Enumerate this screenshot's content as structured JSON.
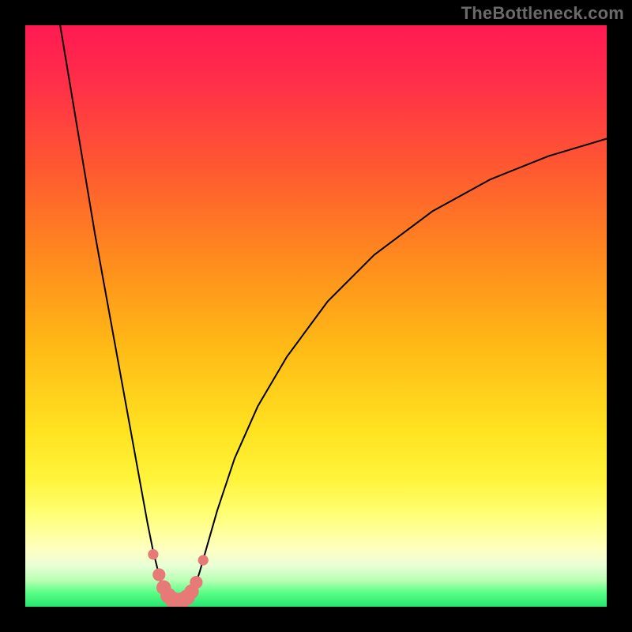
{
  "watermark": {
    "text": "TheBottleneck.com"
  },
  "gradient": {
    "stops": [
      {
        "offset": 0.0,
        "color": "#ff1a52"
      },
      {
        "offset": 0.1,
        "color": "#ff2f49"
      },
      {
        "offset": 0.25,
        "color": "#ff5a30"
      },
      {
        "offset": 0.4,
        "color": "#ff8a1e"
      },
      {
        "offset": 0.55,
        "color": "#ffb915"
      },
      {
        "offset": 0.7,
        "color": "#ffe321"
      },
      {
        "offset": 0.78,
        "color": "#fff43a"
      },
      {
        "offset": 0.84,
        "color": "#ffff74"
      },
      {
        "offset": 0.9,
        "color": "#ffffc0"
      },
      {
        "offset": 0.93,
        "color": "#e8ffd6"
      },
      {
        "offset": 0.955,
        "color": "#b7ffb4"
      },
      {
        "offset": 0.975,
        "color": "#5dff87"
      },
      {
        "offset": 1.0,
        "color": "#25e66f"
      }
    ]
  },
  "chart_data": {
    "type": "line",
    "title": "",
    "xlabel": "",
    "ylabel": "",
    "xlim": [
      0,
      100
    ],
    "ylim": [
      0,
      100
    ],
    "series": [
      {
        "name": "left-branch",
        "x": [
          6,
          8,
          10,
          12,
          14,
          16,
          18,
          20,
          21,
          22,
          23,
          23.5,
          24,
          24.6
        ],
        "y": [
          100,
          88,
          76,
          64,
          53,
          42,
          31,
          20,
          14.5,
          9.5,
          5.5,
          3.6,
          2.3,
          1.6
        ]
      },
      {
        "name": "right-branch",
        "x": [
          28.5,
          29,
          30,
          31,
          33,
          36,
          40,
          45,
          52,
          60,
          70,
          80,
          90,
          100
        ],
        "y": [
          1.6,
          3.0,
          6.0,
          9.5,
          16.5,
          25.5,
          34.5,
          43.0,
          52.5,
          60.5,
          68.0,
          73.5,
          77.5,
          80.5
        ]
      },
      {
        "name": "trough",
        "x": [
          24.6,
          25.0,
          25.6,
          26.4,
          27.2,
          28.0,
          28.5
        ],
        "y": [
          1.6,
          1.1,
          0.85,
          0.8,
          0.85,
          1.1,
          1.6
        ]
      }
    ],
    "markers": {
      "name": "highlight-dots",
      "color": "#e77a76",
      "points": [
        {
          "x": 22.0,
          "y": 9.0,
          "r": 0.9
        },
        {
          "x": 23.0,
          "y": 5.5,
          "r": 1.1
        },
        {
          "x": 23.8,
          "y": 3.3,
          "r": 1.25
        },
        {
          "x": 24.6,
          "y": 1.9,
          "r": 1.35
        },
        {
          "x": 25.4,
          "y": 1.2,
          "r": 1.4
        },
        {
          "x": 26.2,
          "y": 1.0,
          "r": 1.4
        },
        {
          "x": 27.0,
          "y": 1.1,
          "r": 1.4
        },
        {
          "x": 27.8,
          "y": 1.6,
          "r": 1.35
        },
        {
          "x": 28.6,
          "y": 2.6,
          "r": 1.25
        },
        {
          "x": 29.4,
          "y": 4.2,
          "r": 1.1
        },
        {
          "x": 30.6,
          "y": 8.0,
          "r": 0.9
        }
      ]
    }
  }
}
